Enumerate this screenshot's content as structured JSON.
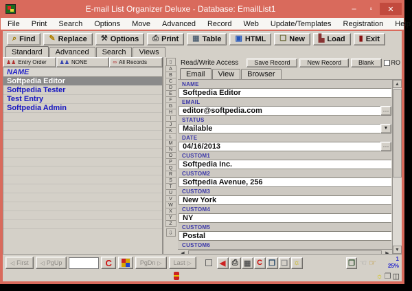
{
  "colors": {
    "titlebar": "#d96a5c",
    "close_button": "#c24a3e",
    "ui_gray": "#d4d0c8",
    "selected_row": "#8a8a8a",
    "list_text": "#1616c0",
    "field_label": "#3a36a8"
  },
  "window": {
    "title": "E-mail List Organizer Deluxe - Database: EmailList1",
    "minimize_glyph": "–",
    "maximize_glyph": "▫",
    "close_glyph": "✕"
  },
  "menu_items": [
    "File",
    "Print",
    "Search",
    "Options",
    "Move",
    "Advanced",
    "Record",
    "Web",
    "Update/Templates",
    "Registration",
    "Help"
  ],
  "toolbar_buttons": [
    {
      "label": "Find",
      "icon": "find-magnifier-icon",
      "glyph": "⌕",
      "color": "#a07800"
    },
    {
      "label": "Replace",
      "icon": "replace-icon",
      "glyph": "✎",
      "color": "#b08000"
    },
    {
      "label": "Options",
      "icon": "options-tools-icon",
      "glyph": "⚒",
      "color": "#333333"
    },
    {
      "label": "Print",
      "icon": "print-icon",
      "glyph": "⎙",
      "color": "#444444"
    },
    {
      "label": "Table",
      "icon": "table-grid-icon",
      "glyph": "▦",
      "color": "#556677"
    },
    {
      "label": "HTML",
      "icon": "html-icon",
      "glyph": "▣",
      "color": "#2255bb"
    },
    {
      "label": "New",
      "icon": "new-page-icon",
      "glyph": "❏",
      "color": "#666633"
    },
    {
      "label": "Load",
      "icon": "load-books-icon",
      "glyph": "▙",
      "color": "#883333"
    },
    {
      "label": "Exit",
      "icon": "exit-icon",
      "glyph": "▮",
      "color": "#881111"
    }
  ],
  "view_tabs": [
    "Standard",
    "Advanced",
    "Search",
    "Views"
  ],
  "active_view_tab": 0,
  "left_panel": {
    "sort_buttons": [
      {
        "label": "Entry Order",
        "icon": "entry-order-people-icon",
        "glyph": "♟♟",
        "color": "#b03030"
      },
      {
        "label": "NONE",
        "icon": "sort-none-people-icon",
        "glyph": "♟♟",
        "color": "#3040b0"
      },
      {
        "label": "All Records",
        "icon": "all-records-glasses-icon",
        "glyph": "∞",
        "color": "#b03030"
      }
    ],
    "column_header": "NAME",
    "rows": [
      "Softpedia Editor",
      "Softpedia Tester",
      "Test Entry",
      "Softpedia Admin"
    ],
    "selected_index": 0
  },
  "alphabet_letters": [
    "A",
    "B",
    "C",
    "D",
    "E",
    "F",
    "G",
    "H",
    "I",
    "J",
    "K",
    "L",
    "M",
    "N",
    "O",
    "P",
    "Q",
    "R",
    "S",
    "T",
    "U",
    "V",
    "W",
    "X",
    "Y",
    "Z"
  ],
  "record_panel": {
    "access_label": "Read/Write Access",
    "buttons": [
      "Save Record",
      "New Record",
      "Blank"
    ],
    "ro_label": "RO",
    "tabs": [
      "Email",
      "View",
      "Browser"
    ],
    "active_tab_index": 0,
    "fields": [
      {
        "label": "NAME",
        "value": "Softpedia Editor",
        "type": "text"
      },
      {
        "label": "EMAIL",
        "value": "editor@softpedia.com",
        "type": "ellipsis"
      },
      {
        "label": "STATUS",
        "value": "Mailable",
        "type": "dropdown"
      },
      {
        "label": "DATE",
        "value": "04/16/2013",
        "type": "ellipsis"
      },
      {
        "label": "CUSTOM1",
        "value": "Softpedia Inc.",
        "type": "text"
      },
      {
        "label": "CUSTOM2",
        "value": "Softpedia Avenue, 256",
        "type": "text"
      },
      {
        "label": "CUSTOM3",
        "value": "New York",
        "type": "text"
      },
      {
        "label": "CUSTOM4",
        "value": "NY",
        "type": "text"
      },
      {
        "label": "CUSTOM5",
        "value": "Postal",
        "type": "text"
      },
      {
        "label": "CUSTOM6",
        "value": "",
        "type": "label-only"
      }
    ]
  },
  "glyphs": {
    "ellipsis": "···",
    "dropdown": "▼",
    "up": "▲",
    "down": "▼",
    "left": "◀",
    "right": "▶"
  },
  "bottom_bar": {
    "first_label": "First",
    "pgup_label": "PgUp",
    "pgdn_label": "PgDn",
    "last_label": "Last",
    "record_number_value": "",
    "tool_icons": [
      {
        "name": "back-arrow-icon",
        "glyph": "◀",
        "color": "#cc2222"
      },
      {
        "name": "print-record-icon",
        "glyph": "⎙",
        "color": "#333333"
      },
      {
        "name": "delete-record-icon",
        "glyph": "▦",
        "color": "#555555"
      },
      {
        "name": "copyright-icon",
        "glyph": "C",
        "color": "#cc1111"
      },
      {
        "name": "copy-record-icon",
        "glyph": "❐",
        "color": "#224466"
      },
      {
        "name": "duplicate-record-icon",
        "glyph": "❏",
        "color": "#888888"
      },
      {
        "name": "tip-bulb-icon",
        "glyph": "☼",
        "color": "#c8b400"
      }
    ],
    "export_icon": {
      "name": "export-record-icon",
      "glyph": "❐",
      "color": "#335533"
    },
    "prev_hand_glyph": "☜",
    "next_hand_glyph": "☞",
    "record_counter": "1",
    "zoom_level": "25%"
  },
  "status_bar": {
    "icons": [
      {
        "name": "hint-bulb-icon",
        "glyph": "☼",
        "color": "#d4c500"
      },
      {
        "name": "documents-icon",
        "glyph": "❐",
        "color": "#555555"
      },
      {
        "name": "attachment-icon",
        "glyph": "◫",
        "color": "#333333"
      }
    ]
  }
}
